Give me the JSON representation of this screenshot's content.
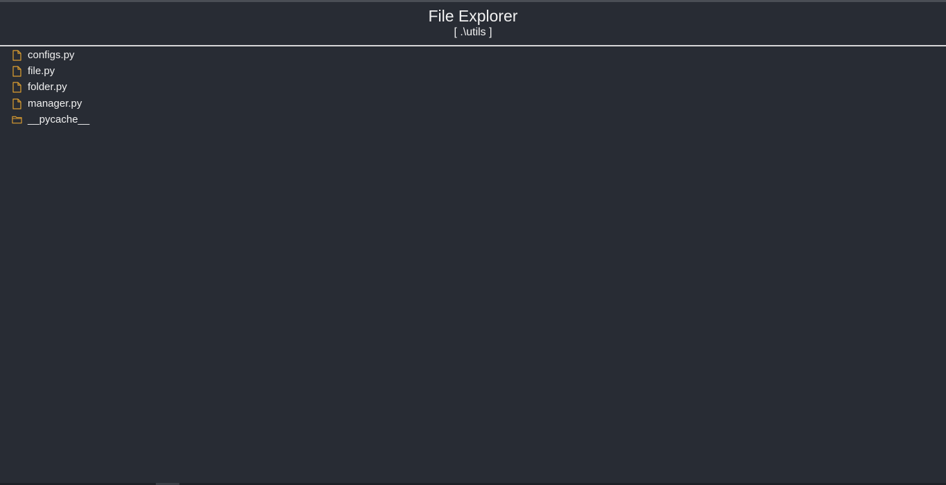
{
  "header": {
    "title": "File Explorer",
    "path": "[ .\\utils ]"
  },
  "colors": {
    "background": "#282c34",
    "icon_accent": "#e0a030",
    "divider": "#d8d8d8"
  },
  "items": [
    {
      "name": "configs.py",
      "icon": "file-icon"
    },
    {
      "name": "file.py",
      "icon": "file-icon"
    },
    {
      "name": "folder.py",
      "icon": "file-icon"
    },
    {
      "name": "manager.py",
      "icon": "file-icon"
    },
    {
      "name": "__pycache__",
      "icon": "folder-icon"
    }
  ]
}
